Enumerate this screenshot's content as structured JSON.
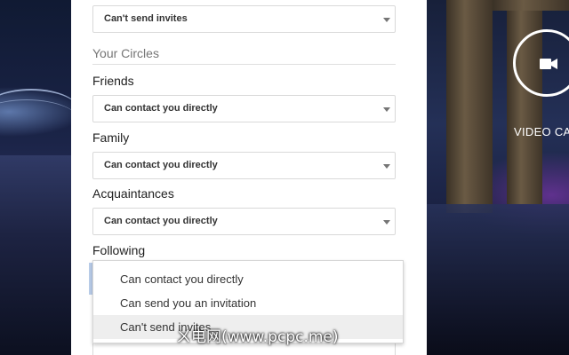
{
  "invites_select": {
    "value": "Can't send invites"
  },
  "your_circles": {
    "title": "Your Circles"
  },
  "circles": [
    {
      "label": "Friends",
      "value": "Can contact you directly"
    },
    {
      "label": "Family",
      "value": "Can contact you directly"
    },
    {
      "label": "Acquaintances",
      "value": "Can contact you directly"
    },
    {
      "label": "Following"
    }
  ],
  "dropdown": {
    "options": [
      "Can contact you directly",
      "Can send you an invitation",
      "Can't send invites"
    ],
    "highlighted_index": 2
  },
  "video_call": {
    "label": "VIDEO CA",
    "icon": "video-camera-icon"
  },
  "watermark": {
    "text": "ㄨ电网(www.pcpc.me)"
  },
  "colors": {
    "panel_bg": "#ffffff",
    "highlight": "#eeeeee"
  }
}
